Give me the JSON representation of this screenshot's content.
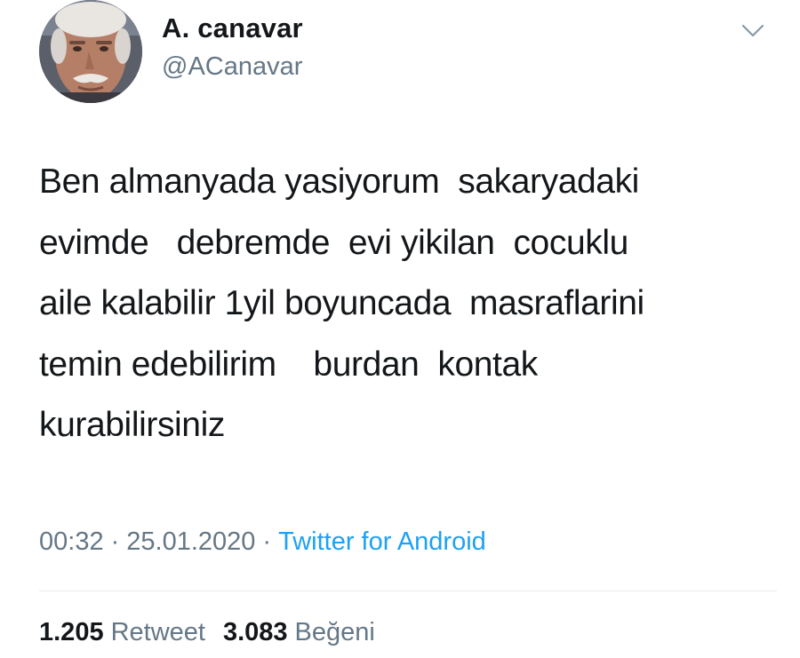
{
  "user": {
    "display_name": "A. canavar",
    "handle": "@ACanavar"
  },
  "icons": {
    "menu": "chevron-down-icon",
    "avatar": "profile-photo"
  },
  "tweet": {
    "text": "Ben almanyada yasiyorum  sakaryadaki\nevimde   debremde  evi yikilan  cocuklu\naile kalabilir 1yil boyuncada  masraflarini\ntemin edebilirim    burdan  kontak\nkurabilirsiniz"
  },
  "meta": {
    "time": "00:32",
    "separator": "·",
    "date": "25.01.2020",
    "source": "Twitter for Android"
  },
  "stats": {
    "retweets": "1.205",
    "retweets_label": "Retweet",
    "likes": "3.083",
    "likes_label": "Beğeni"
  },
  "colors": {
    "text": "#14171a",
    "secondary": "#657786",
    "link": "#1da1f2",
    "divider": "#e6ecf0"
  }
}
